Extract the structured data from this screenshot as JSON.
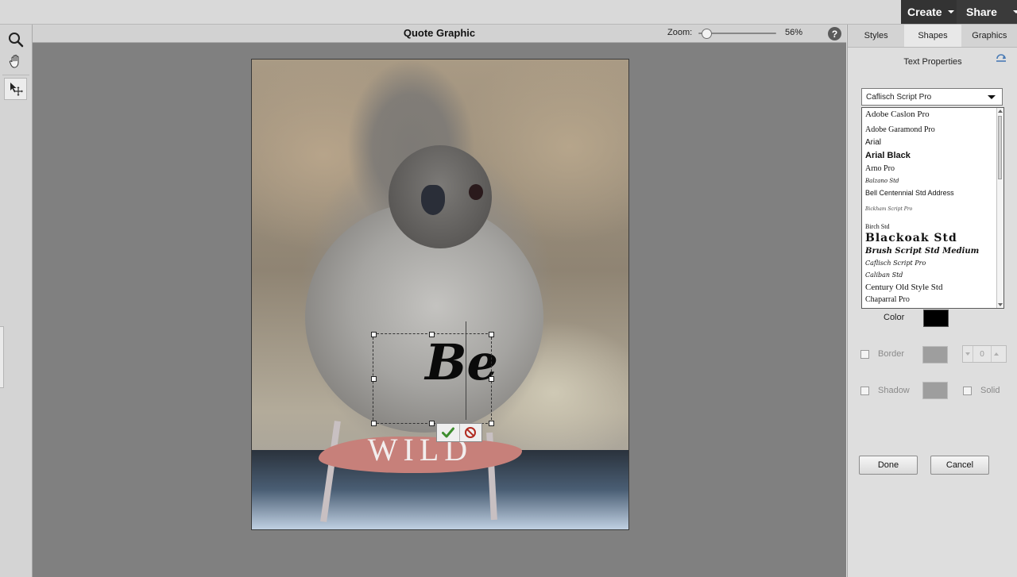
{
  "topbar": {
    "create_label": "Create",
    "share_label": "Share"
  },
  "document": {
    "title": "Quote Graphic"
  },
  "zoom": {
    "label": "Zoom:",
    "value_text": "56%",
    "value": 56,
    "help_label": "?"
  },
  "canvas": {
    "text_top": "Be",
    "text_bottom": "WILD"
  },
  "panel": {
    "tabs": [
      {
        "label": "Styles"
      },
      {
        "label": "Shapes"
      },
      {
        "label": "Graphics"
      }
    ],
    "title": "Text Properties",
    "font_select_value": "Caflisch Script Pro",
    "font_list": [
      "Adobe Caslon Pro",
      "Adobe Garamond Pro",
      "Arial",
      "Arial Black",
      "Arno Pro",
      "Balzano Std",
      "Bell Centennial Std Address",
      "Bickham Script Pro",
      "Birch Std",
      "Blackoak Std",
      "Brush Script Std Medium",
      "Caflisch Script Pro",
      "Caliban Std",
      "Century Old Style Std",
      "Chaparral Pro"
    ],
    "color_label": "Color",
    "border_label": "Border",
    "border_value": "0",
    "shadow_label": "Shadow",
    "solid_label": "Solid",
    "done_label": "Done",
    "cancel_label": "Cancel"
  },
  "colors": {
    "text_color": "#000000",
    "brush_stroke": "#c7807a",
    "disabled_swatch": "#9e9e9e",
    "topbar_button": "#3c3c3c"
  },
  "icons": [
    "zoom-icon",
    "hand-icon",
    "move-icon",
    "checkmark-icon",
    "cancel-icon",
    "help-icon",
    "reset-icon"
  ]
}
